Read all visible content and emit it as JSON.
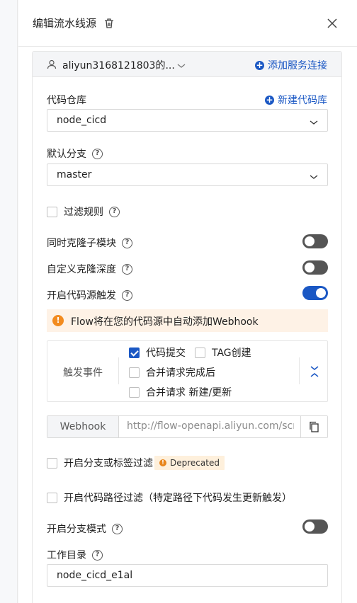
{
  "drawer": {
    "title": "编辑流水线源"
  },
  "account": {
    "name": "aliyun3168121803的...",
    "add_connection": "添加服务连接"
  },
  "repo": {
    "label": "代码仓库",
    "new_repo": "新建代码库",
    "value": "node_cicd"
  },
  "branch": {
    "label": "默认分支",
    "value": "master"
  },
  "filter_rules": {
    "label": "过滤规则",
    "checked": false
  },
  "clone_submodules": {
    "label": "同时克隆子模块",
    "enabled": false
  },
  "clone_depth": {
    "label": "自定义克隆深度",
    "enabled": false
  },
  "source_trigger": {
    "label": "开启代码源触发",
    "enabled": true
  },
  "notice": {
    "text": "Flow将在您的代码源中自动添加Webhook"
  },
  "trigger_events": {
    "label": "触发事件",
    "options": [
      {
        "label": "代码提交",
        "checked": true
      },
      {
        "label": "TAG创建",
        "checked": false
      },
      {
        "label": "合并请求完成后",
        "checked": false
      },
      {
        "label": "合并请求 新建/更新",
        "checked": false
      }
    ]
  },
  "webhook": {
    "label": "Webhook",
    "url": "http://flow-openapi.aliyun.com/scm/"
  },
  "branch_tag_filter": {
    "label": "开启分支或标签过滤",
    "badge": "Deprecated",
    "checked": false
  },
  "path_filter": {
    "label": "开启代码路径过滤（特定路径下代码发生更新触发）",
    "checked": false
  },
  "branch_mode": {
    "label": "开启分支模式",
    "enabled": false
  },
  "workdir": {
    "label": "工作目录",
    "value": "node_cicd_e1al"
  },
  "colors": {
    "accent": "#1b58c4",
    "warning": "#f28b1f"
  }
}
